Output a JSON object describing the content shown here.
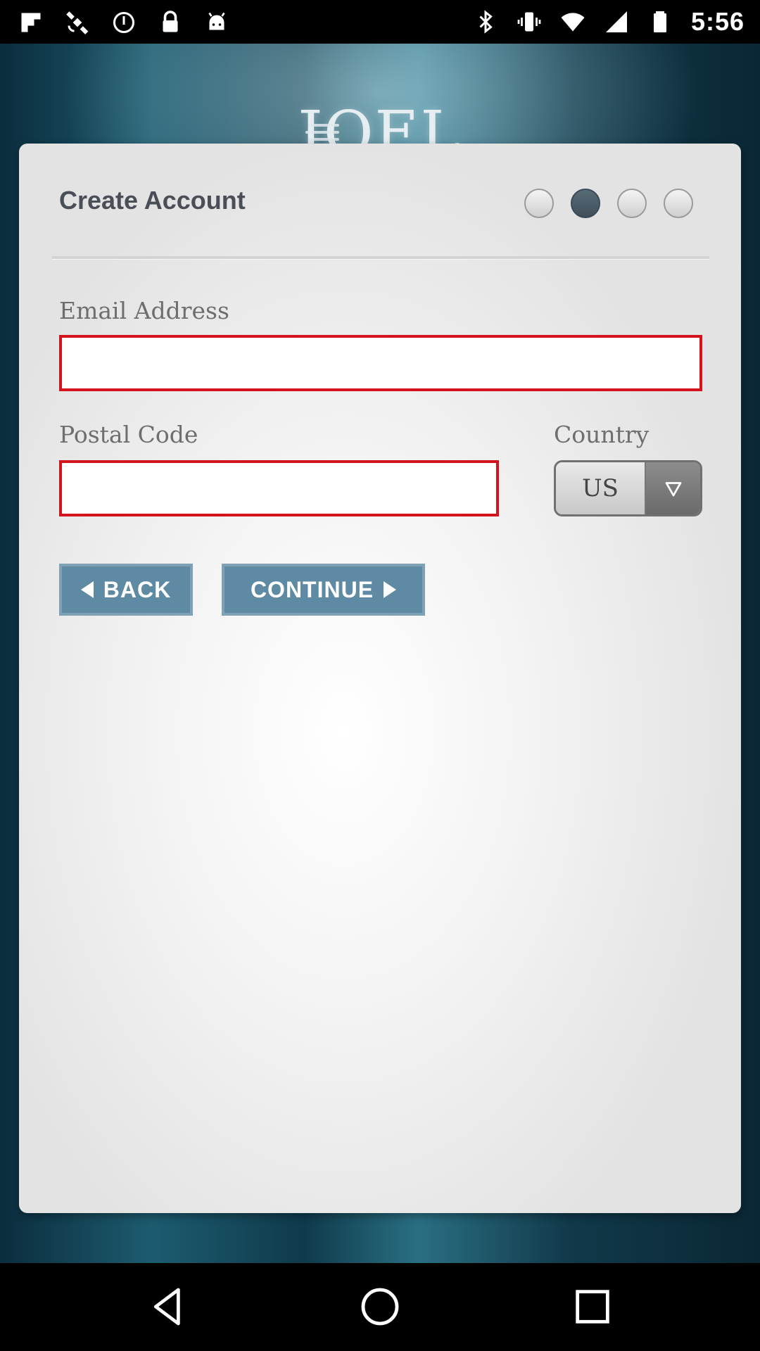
{
  "status_bar": {
    "time": "5:56",
    "left_icons": [
      "flipboard-icon",
      "satellite-icon",
      "alarm-icon",
      "lock-icon",
      "android-icon"
    ],
    "right_icons": [
      "bluetooth-icon",
      "vibrate-icon",
      "wifi-icon",
      "signal-icon",
      "battery-icon"
    ]
  },
  "app": {
    "logo_text": "JOEL"
  },
  "form": {
    "title": "Create Account",
    "steps": {
      "count": 4,
      "current": 2
    },
    "email_label": "Email Address",
    "email_value": "",
    "postal_label": "Postal Code",
    "postal_value": "",
    "country_label": "Country",
    "country_value": "US",
    "back_label": "BACK",
    "continue_label": "CONTINUE"
  },
  "nav_bar": {
    "buttons": [
      "back-icon",
      "home-icon",
      "recents-icon"
    ]
  }
}
